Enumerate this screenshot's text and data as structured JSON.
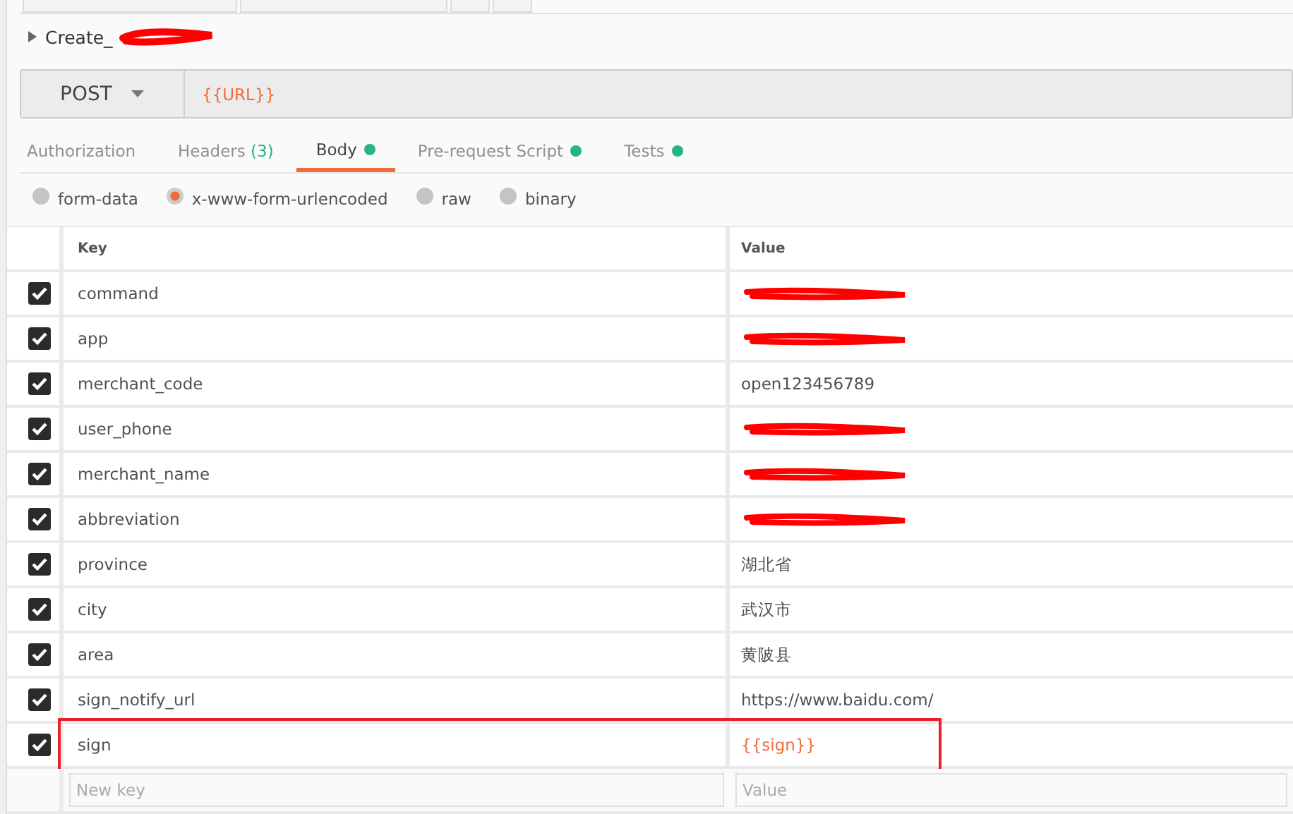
{
  "request": {
    "name": "Create_",
    "name_redacted": true,
    "method": "POST",
    "url": "{{URL}}"
  },
  "tabs": [
    {
      "label": "Authorization",
      "selected": false
    },
    {
      "label": "Headers",
      "count": "(3)",
      "selected": false
    },
    {
      "label": "Body",
      "dot": true,
      "selected": true
    },
    {
      "label": "Pre-request Script",
      "dot": true,
      "selected": false
    },
    {
      "label": "Tests",
      "dot": true,
      "selected": false
    }
  ],
  "body_types": [
    {
      "label": "form-data",
      "selected": false
    },
    {
      "label": "x-www-form-urlencoded",
      "selected": true
    },
    {
      "label": "raw",
      "selected": false
    },
    {
      "label": "binary",
      "selected": false
    }
  ],
  "table": {
    "columns": [
      "Key",
      "Value"
    ],
    "rows": [
      {
        "checked": true,
        "key": "command",
        "redacted": true,
        "highlighted": false
      },
      {
        "checked": true,
        "key": "app",
        "redacted": true,
        "highlighted": false
      },
      {
        "checked": true,
        "key": "merchant_code",
        "value": "open123456789",
        "redacted": false,
        "highlighted": false
      },
      {
        "checked": true,
        "key": "user_phone",
        "redacted": true,
        "highlighted": false
      },
      {
        "checked": true,
        "key": "merchant_name",
        "redacted": true,
        "highlighted": false
      },
      {
        "checked": true,
        "key": "abbreviation",
        "redacted": true,
        "highlighted": false
      },
      {
        "checked": true,
        "key": "province",
        "value": "湖北省",
        "redacted": false,
        "highlighted": false
      },
      {
        "checked": true,
        "key": "city",
        "value": "武汉市",
        "redacted": false,
        "highlighted": false
      },
      {
        "checked": true,
        "key": "area",
        "value": "黄陂县",
        "redacted": false,
        "highlighted": false
      },
      {
        "checked": true,
        "key": "sign_notify_url",
        "value": "https://www.baidu.com/",
        "redacted": false,
        "highlighted": false
      },
      {
        "checked": true,
        "key": "sign",
        "value": "{{sign}}",
        "variable": true,
        "redacted": false,
        "highlighted": true
      }
    ],
    "new_row": {
      "key_placeholder": "New key",
      "value_placeholder": "Value"
    }
  }
}
